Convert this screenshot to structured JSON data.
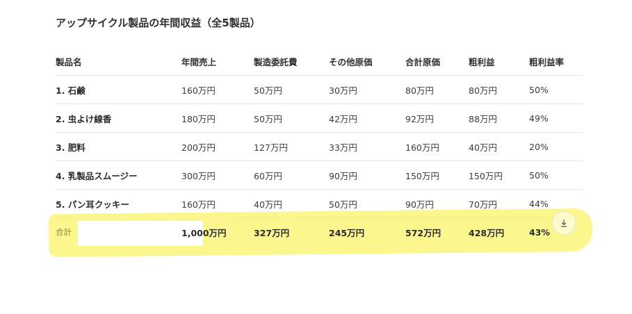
{
  "title": "アップサイクル製品の年間収益（全5製品）",
  "columns": [
    "製品名",
    "年間売上",
    "製造委託費",
    "その他原価",
    "合計原価",
    "粗利益",
    "粗利益率"
  ],
  "rows": [
    [
      "1. 石鹸",
      "160万円",
      "50万円",
      "30万円",
      "80万円",
      "80万円",
      "50%"
    ],
    [
      "2. 虫よけ線香",
      "180万円",
      "50万円",
      "42万円",
      "92万円",
      "88万円",
      "49%"
    ],
    [
      "3. 肥料",
      "200万円",
      "127万円",
      "33万円",
      "160万円",
      "40万円",
      "20%"
    ],
    [
      "4. 乳製品スムージー",
      "300万円",
      "60万円",
      "90万円",
      "150万円",
      "150万円",
      "50%"
    ],
    [
      "5. パン耳クッキー",
      "160万円",
      "40万円",
      "50万円",
      "90万円",
      "70万円",
      "44%"
    ]
  ],
  "total": [
    "合計",
    "1,000万円",
    "327万円",
    "245万円",
    "572万円",
    "428万円",
    "43%"
  ],
  "download_icon": "download-arrow-icon",
  "colors": {
    "highlight": "#fbf68e",
    "divider": "#e6e6e6",
    "text": "#2b2b2b"
  }
}
